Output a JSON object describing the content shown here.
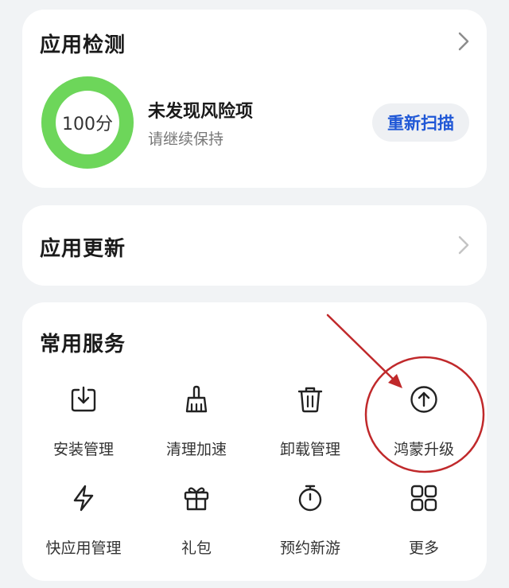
{
  "detect": {
    "title": "应用检测",
    "score": "100分",
    "score_fraction": 1.0,
    "status_title": "未发现风险项",
    "status_sub": "请继续保持",
    "rescan_label": "重新扫描",
    "ring_color": "#6dd65a"
  },
  "update": {
    "title": "应用更新"
  },
  "services": {
    "title": "常用服务",
    "items": [
      {
        "label": "安装管理",
        "icon": "install-icon"
      },
      {
        "label": "清理加速",
        "icon": "broom-icon"
      },
      {
        "label": "卸载管理",
        "icon": "trash-icon"
      },
      {
        "label": "鸿蒙升级",
        "icon": "upgrade-arrow-icon"
      },
      {
        "label": "快应用管理",
        "icon": "lightning-icon"
      },
      {
        "label": "礼包",
        "icon": "gift-icon"
      },
      {
        "label": "预约新游",
        "icon": "stopwatch-icon"
      },
      {
        "label": "更多",
        "icon": "grid-icon"
      }
    ]
  },
  "colors": {
    "accent": "#1f57d6",
    "annotation": "#c0292b"
  }
}
